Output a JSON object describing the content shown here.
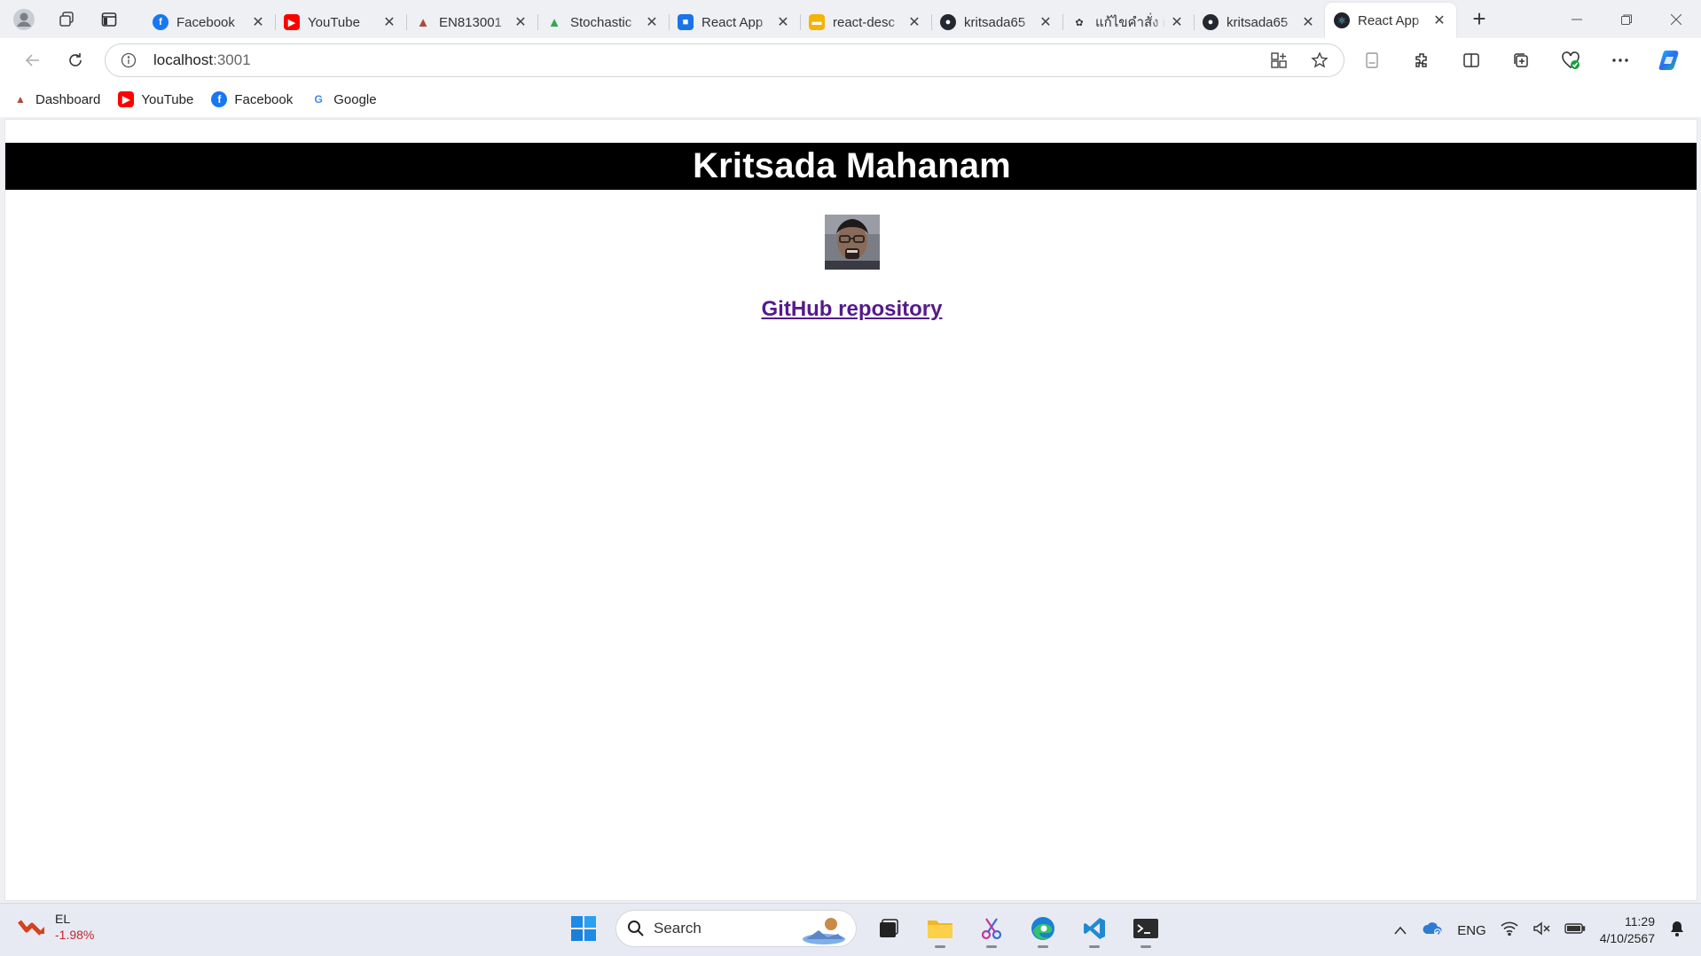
{
  "browser": {
    "tabs": [
      {
        "title": "Facebook",
        "favicon": "facebook-icon",
        "color": "#1877f2",
        "active": false
      },
      {
        "title": "YouTube",
        "favicon": "youtube-icon",
        "color": "#ff0000",
        "active": false
      },
      {
        "title": "EN813001",
        "favicon": "canvas-icon",
        "color": "#b04a3a",
        "active": false
      },
      {
        "title": "Stochastic",
        "favicon": "google-drive-icon",
        "color": "#34a853",
        "active": false
      },
      {
        "title": "React App",
        "favicon": "classroom-icon",
        "color": "#1a73e8",
        "active": false
      },
      {
        "title": "react-desc",
        "favicon": "slides-icon",
        "color": "#f4b400",
        "active": false
      },
      {
        "title": "kritsada65",
        "favicon": "github-icon",
        "color": "#24292f",
        "active": false
      },
      {
        "title": "แก้ไขคำสั่ง n",
        "favicon": "chatgpt-icon",
        "color": "#333333",
        "active": false
      },
      {
        "title": "kritsada65",
        "favicon": "github-icon",
        "color": "#24292f",
        "active": false
      },
      {
        "title": "React App",
        "favicon": "react-icon",
        "color": "#61dafb",
        "active": true
      }
    ],
    "address": {
      "host": "localhost",
      "port": ":3001"
    },
    "bookmarks": [
      {
        "label": "Dashboard",
        "icon": "canvas-icon"
      },
      {
        "label": "YouTube",
        "icon": "youtube-icon"
      },
      {
        "label": "Facebook",
        "icon": "facebook-icon"
      },
      {
        "label": "Google",
        "icon": "google-icon"
      }
    ]
  },
  "page": {
    "title": "Kritsada Mahanam",
    "link_label": "GitHub repository",
    "link_color": "#551a8b",
    "header_bg": "#000000"
  },
  "taskbar": {
    "widget": {
      "symbol": "EL",
      "change": "-1.98%"
    },
    "search_label": "Search",
    "tray": {
      "language": "ENG",
      "time": "11:29",
      "date": "4/10/2567"
    }
  }
}
